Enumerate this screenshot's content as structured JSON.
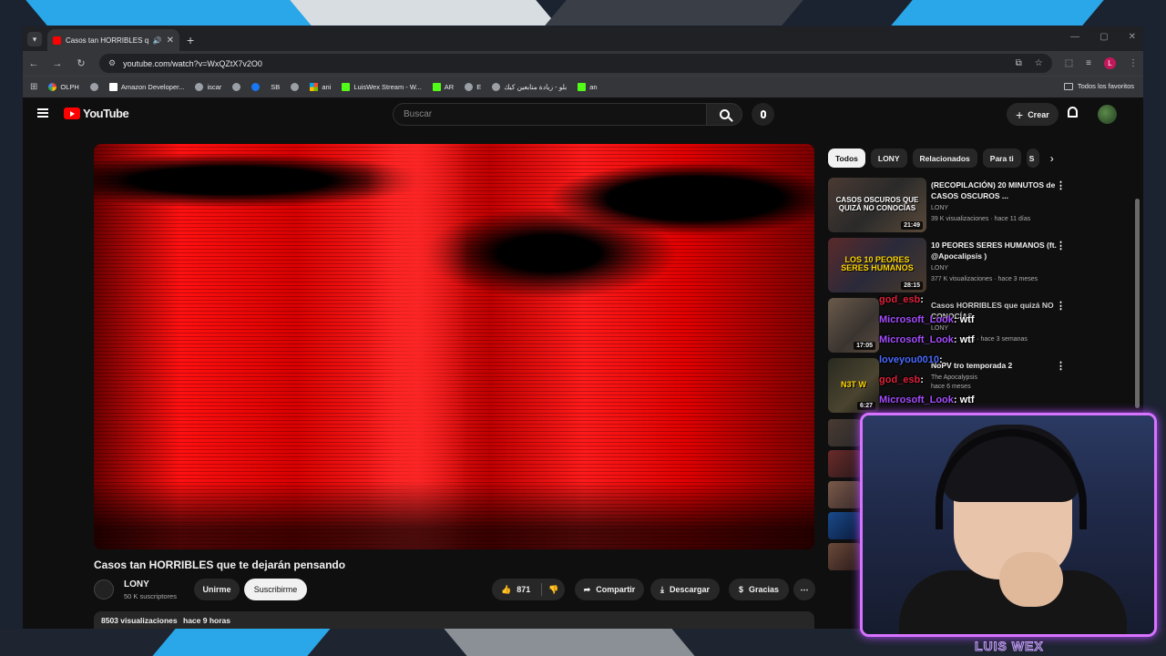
{
  "browser": {
    "tab_title": "Casos tan HORRIBLES que …",
    "url": "youtube.com/watch?v=WxQZtX7v2O0",
    "bookmarks": [
      "OLPH",
      "Amazon Developer...",
      "iscar",
      "SB",
      "ani",
      "LuisWex Stream - W...",
      "AR",
      "E",
      "بلو - زيادة متابعين كيك",
      "an"
    ],
    "all_bookmarks": "Todos los favoritos"
  },
  "youtube": {
    "logo_text": "YouTube",
    "search_placeholder": "Buscar",
    "create_label": "Crear",
    "video_title": "Casos tan HORRIBLES que te dejarán pensando",
    "channel": {
      "name": "LONY",
      "subscribers": "50 K suscriptores",
      "join_label": "Unirme",
      "subscribe_label": "Suscribirme"
    },
    "actions": {
      "likes": "871",
      "share": "Compartir",
      "download": "Descargar",
      "thanks": "Gracias"
    },
    "description": {
      "views": "8503 visualizaciones",
      "age": "hace 9 horas"
    },
    "chips": [
      "Todos",
      "LONY",
      "Relacionados",
      "Para ti",
      "S"
    ],
    "recommendations": [
      {
        "title": "(RECOPILACIÓN) 20 MINUTOS de CASOS OSCUROS ...",
        "thumb_text": "CASOS OSCUROS QUE QUIZÁ NO CONOCÍAS",
        "channel": "LONY",
        "meta": "39 K visualizaciones · hace 11 días",
        "duration": "21:49"
      },
      {
        "title": "10 PEORES SERES HUMANOS (ft. @Apocalipsis )",
        "thumb_text": "LOS 10 PEORES SERES HUMANOS",
        "channel": "LONY",
        "meta": "377 K visualizaciones · hace 3 meses",
        "duration": "28:15"
      },
      {
        "title": "Casos HORRIBLES que quizá NO CONOCÍAS",
        "channel": "LONY",
        "meta": "nes · hace 3 semanas",
        "duration": "17:05"
      },
      {
        "title": "NoPV tro temporada 2",
        "thumb_text": "N3T W",
        "channel": "The Apocalypsis",
        "meta": "hace 6 meses",
        "duration": "6:27"
      }
    ]
  },
  "chat": [
    {
      "user": "god_esb",
      "message": ":"
    },
    {
      "user": "Microsoft_Look",
      "message": ": wtf"
    },
    {
      "user": "Microsoft_Look",
      "message": ": wtf"
    },
    {
      "user": "loveyou0010",
      "message": ":"
    },
    {
      "user": "god_esb",
      "message": ":"
    },
    {
      "user": "Microsoft_Look",
      "message": ": wtf"
    }
  ],
  "stream": {
    "webcam_label": "LUIS WEX"
  },
  "colors": {
    "yt_red": "#ff0000",
    "accent_blue": "#2aa7e8",
    "webcam_border": "#d873ff"
  }
}
